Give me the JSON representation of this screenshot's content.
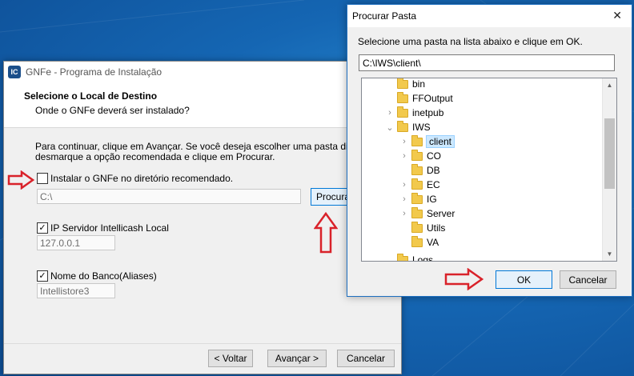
{
  "installer": {
    "title": "GNFe - Programa de Instalação",
    "app_icon_text": "IC",
    "header_title": "Selecione o Local de Destino",
    "header_subtitle": "Onde o GNFe deverá ser instalado?",
    "intro_text": "Para continuar, clique em Avançar. Se você deseja escolher uma pasta diferente,\ndesmarque a opção recomendada e clique em Procurar.",
    "recommended_dir": {
      "label": "Instalar o GNFe no diretório recomendado.",
      "checked": false
    },
    "path_value": "C:\\",
    "browse_button": "Procurar",
    "ip_server": {
      "label": "IP Servidor Intellicash Local",
      "checked": true,
      "value": "127.0.0.1"
    },
    "db_name": {
      "label": "Nome do Banco(Aliases)",
      "checked": true,
      "value": "Intellistore3"
    },
    "footer": {
      "back": "< Voltar",
      "next": "Avançar >",
      "cancel": "Cancelar"
    }
  },
  "folder_dialog": {
    "title": "Procurar Pasta",
    "message": "Selecione uma pasta na lista abaixo e clique em OK.",
    "path": "C:\\IWS\\client\\",
    "tree": [
      {
        "label": "bin",
        "chevron": ""
      },
      {
        "label": "FFOutput",
        "chevron": ""
      },
      {
        "label": "inetpub",
        "chevron": ">"
      },
      {
        "label": "IWS",
        "chevron": "v"
      },
      {
        "label": "client",
        "chevron": ">",
        "selected": true
      },
      {
        "label": "CO",
        "chevron": ">"
      },
      {
        "label": "DB",
        "chevron": ""
      },
      {
        "label": "EC",
        "chevron": ">"
      },
      {
        "label": "IG",
        "chevron": ">"
      },
      {
        "label": "Server",
        "chevron": ">"
      },
      {
        "label": "Utils",
        "chevron": ""
      },
      {
        "label": "VA",
        "chevron": ""
      },
      {
        "label": "Logs",
        "chevron": ""
      }
    ],
    "ok": "OK",
    "cancel": "Cancelar"
  },
  "colors": {
    "arrow_red": "#d9222a",
    "accent": "#0078d7",
    "selection": "#cce8ff"
  }
}
